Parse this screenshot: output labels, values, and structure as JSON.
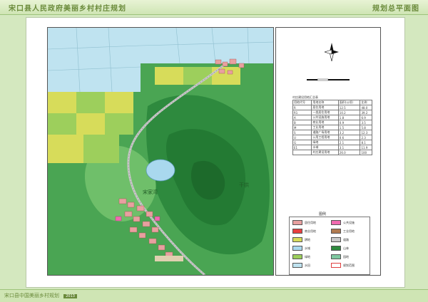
{
  "header": {
    "title": "宋口县人民政府美丽乡村村庄规划",
    "subtitle": "规划总平面图"
  },
  "map": {
    "labels": [
      "干拱",
      "宋家湾"
    ],
    "colors": {
      "mountain_dark": "#2e8a3e",
      "mountain_mid": "#4aa553",
      "mountain_light": "#6fbf6a",
      "farmland_yellow": "#d7dc5a",
      "farmland_green": "#9dcf5c",
      "paddy_blue": "#bfe3f0",
      "water": "#a9d8ee",
      "road": "#c9c9c9",
      "residential": "#e8a0a0"
    }
  },
  "stats": {
    "caption": "村庄建设用地汇总表",
    "header": [
      "用地代号",
      "用地名称",
      "面积(公顷)",
      "比例"
    ],
    "rows": [
      [
        "R",
        "居住用地",
        "12.5",
        "48.0"
      ],
      [
        "R1",
        "一类居住用地",
        "10.2",
        "39.2"
      ],
      [
        "A",
        "公共设施用地",
        "1.8",
        "6.9"
      ],
      [
        "B",
        "商业用地",
        "0.9",
        "3.5"
      ],
      [
        "M",
        "工业用地",
        "1.5",
        "5.8"
      ],
      [
        "S",
        "道路广场用地",
        "3.2",
        "12.3"
      ],
      [
        "U",
        "公用工程用地",
        "0.6",
        "2.3"
      ],
      [
        "G",
        "绿地",
        "2.1",
        "8.1"
      ],
      [
        "E1",
        "水域",
        "3.1",
        "11.9"
      ],
      [
        "",
        "村庄建设用地",
        "26.0",
        "100"
      ]
    ]
  },
  "legend": {
    "title": "图例",
    "items": [
      {
        "label": "居住用地",
        "color": "#e8a0a0"
      },
      {
        "label": "公共设施",
        "color": "#f06ab0"
      },
      {
        "label": "商业用地",
        "color": "#e84040"
      },
      {
        "label": "工业用地",
        "color": "#b07a50"
      },
      {
        "label": "耕地",
        "color": "#d7dc5a"
      },
      {
        "label": "道路",
        "color": "#c9c9c9"
      },
      {
        "label": "水域",
        "color": "#a9d8ee"
      },
      {
        "label": "山林",
        "color": "#2e8a3e"
      },
      {
        "label": "绿地",
        "color": "#9dcf5c"
      },
      {
        "label": "园地",
        "color": "#7fc8a0"
      },
      {
        "label": "水田",
        "color": "#bfe3f0"
      },
      {
        "label": "规划范围",
        "color": "#ffffff"
      }
    ]
  },
  "footer": {
    "text": "宋口县中国美丽乡村规划",
    "badge": "2013"
  }
}
